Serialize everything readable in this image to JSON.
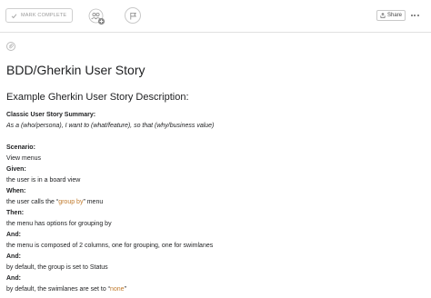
{
  "toolbar": {
    "mark_complete_label": "MARK COMPLETE",
    "share_label": "Share",
    "check_icon": "check-icon",
    "collaborators_icon": "add-collaborator-icon",
    "flag_icon": "flag-icon",
    "more_icon": "more-icon"
  },
  "task": {
    "title": "BDD/Gherkin User Story"
  },
  "description": {
    "heading": "Example Gherkin User Story Description:",
    "summary_label": "Classic User Story Summary:",
    "summary_text": "As a (who/persona), I want to (what/feature), so that (why/business value)",
    "scenario_label": "Scenario:",
    "scenario_text": "View menus",
    "given_label": "Given:",
    "given_text": "the user is in a board view",
    "when_label": "When:",
    "when_prefix": "the user calls the “",
    "when_highlight": "group by",
    "when_suffix": "” menu",
    "then_label": "Then:",
    "then_text": "the menu has options for grouping by",
    "and1_label": "And:",
    "and1_text": "the menu is composed of 2 columns, one for grouping, one for swimlanes",
    "and2_label": "And:",
    "and2_text": "by default, the group is set to Status",
    "and3_label": "And:",
    "and3_prefix": "by default, the swimlanes are set to “",
    "and3_highlight": "none",
    "and3_suffix": "”"
  },
  "colors": {
    "highlight": "#c07a2c",
    "text": "#1e1f21",
    "muted": "#9a9a9a",
    "border": "#e0e0e0"
  }
}
